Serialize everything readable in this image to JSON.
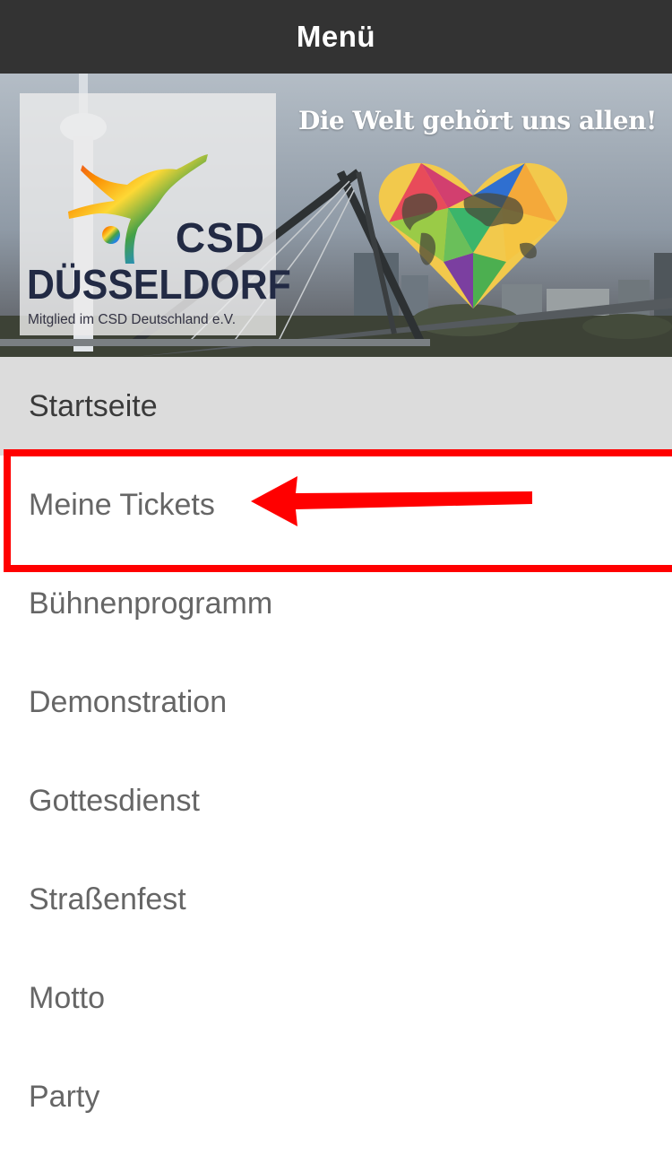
{
  "header": {
    "title": "Menü"
  },
  "banner": {
    "logo": {
      "csd": "CSD",
      "city": "DÜSSELDORF",
      "member": "Mitglied im CSD Deutschland e.V."
    },
    "slogan": "Die Welt gehört uns allen!"
  },
  "menu": {
    "items": [
      {
        "label": "Startseite",
        "active": true
      },
      {
        "label": "Meine Tickets",
        "highlighted": true
      },
      {
        "label": "Bühnenprogramm"
      },
      {
        "label": "Demonstration"
      },
      {
        "label": "Gottesdienst"
      },
      {
        "label": "Straßenfest"
      },
      {
        "label": "Motto"
      },
      {
        "label": "Party"
      }
    ]
  },
  "colors": {
    "topbar": "#333333",
    "active_item_bg": "#dcdcdc",
    "menu_text": "#666666",
    "annotation": "#ff0000"
  },
  "icons": [
    "rainbow-dancer-icon",
    "world-map-heart-icon",
    "annotation-arrow-icon"
  ]
}
